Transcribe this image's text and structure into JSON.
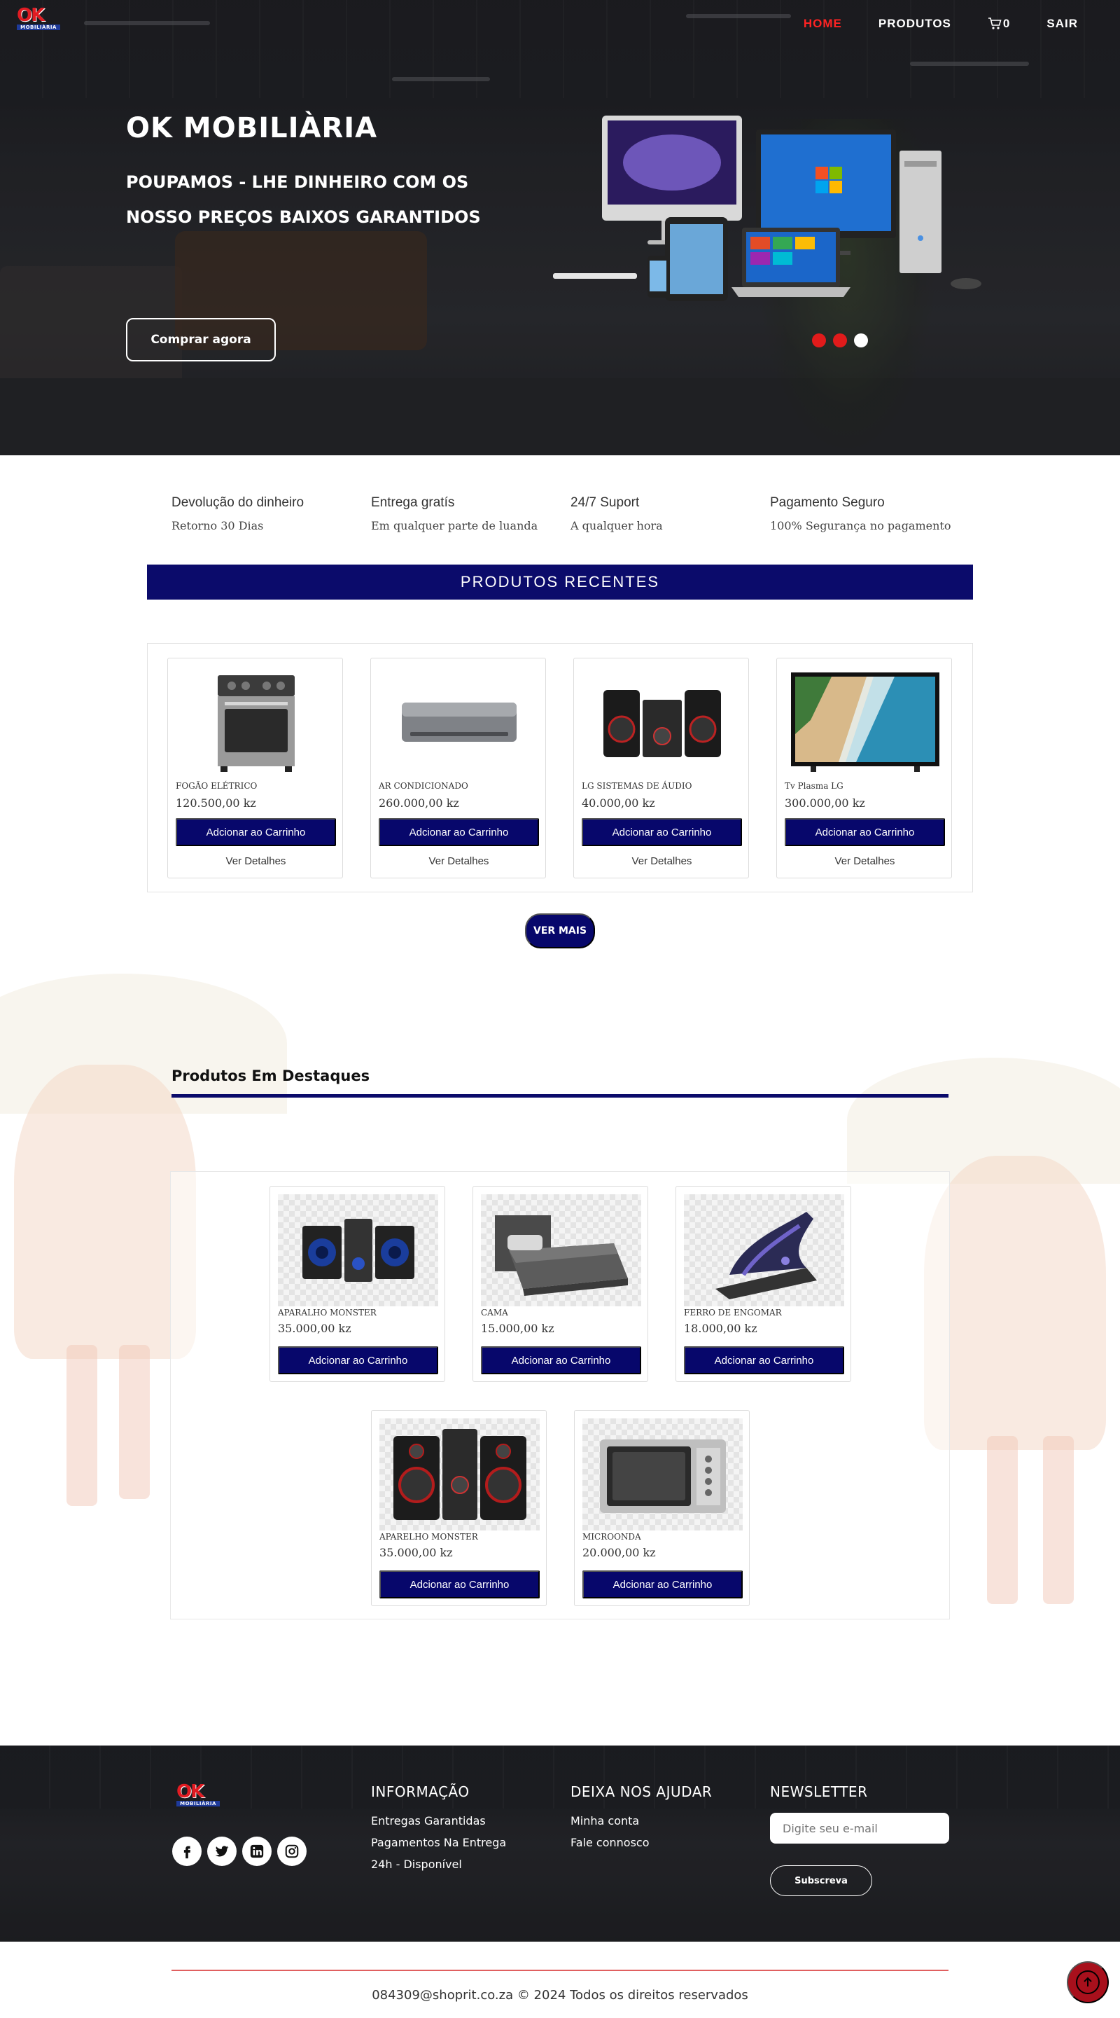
{
  "brand": {
    "logo_text": "OK",
    "logo_sub": "MOBILIÀRIA"
  },
  "nav": {
    "home": "HOME",
    "products": "PRODUTOS",
    "cart_count": "0",
    "logout": "SAIR",
    "active_color": "#ff2323"
  },
  "hero": {
    "title": "OK MOBILIÀRIA",
    "subtitle": "POUPAMOS - LHE DINHEIRO COM OS NOSSO PREÇOS BAIXOS GARANTIDOS",
    "cta": "Comprar agora",
    "slides": 3,
    "active_slide": 3
  },
  "features": [
    {
      "title": "Devolução do dinheiro",
      "desc": "Retorno 30 Dias"
    },
    {
      "title": "Entrega gratís",
      "desc": "Em qualquer parte de luanda"
    },
    {
      "title": "24/7 Suport",
      "desc": "A qualquer hora"
    },
    {
      "title": "Pagamento Seguro",
      "desc": "100% Segurança no pagamento"
    }
  ],
  "recent": {
    "heading": "PRODUTOS RECENTES",
    "add_label": "Adcionar ao Carrinho",
    "details_label": "Ver Detalhes",
    "more_label": "VER MAIS",
    "items": [
      {
        "name": "FOGÃO ELÉTRICO",
        "price": "120.500,00 kz",
        "icon": "stove-icon"
      },
      {
        "name": "AR CONDICIONADO",
        "price": "260.000,00 kz",
        "icon": "air-conditioner-icon"
      },
      {
        "name": "LG SISTEMAS DE ÁUDIO",
        "price": "40.000,00 kz",
        "icon": "audio-system-icon"
      },
      {
        "name": "Tv Plasma LG",
        "price": "300.000,00 kz",
        "icon": "tv-icon"
      }
    ]
  },
  "featured": {
    "heading": "Produtos Em Destaques",
    "add_label": "Adcionar ao Carrinho",
    "items": [
      {
        "name": "APARALHO MONSTER",
        "price": "35.000,00 kz",
        "icon": "speaker-system-icon"
      },
      {
        "name": "CAMA",
        "price": "15.000,00 kz",
        "icon": "bed-icon"
      },
      {
        "name": "FERRO DE ENGOMAR",
        "price": "18.000,00 kz",
        "icon": "iron-icon"
      },
      {
        "name": "APARELHO MONSTER",
        "price": "35.000,00 kz",
        "icon": "speaker-system-icon"
      },
      {
        "name": "MICROONDA",
        "price": "20.000,00 kz",
        "icon": "microwave-icon"
      }
    ]
  },
  "footer": {
    "info": {
      "heading": "INFORMAÇÃO",
      "links": [
        "Entregas Garantidas",
        "Pagamentos Na Entrega",
        "24h - Disponível"
      ]
    },
    "help": {
      "heading": "DEIXA NOS AJUDAR",
      "links": [
        "Minha conta",
        "Fale connosco"
      ]
    },
    "newsletter": {
      "heading": "NEWSLETTER",
      "placeholder": "Digite seu e-mail",
      "button": "Subscreva"
    },
    "social": [
      "facebook-icon",
      "twitter-icon",
      "linkedin-icon",
      "instagram-icon"
    ],
    "copyright": "084309@shoprit.co.za © 2024 Todos os direitos reservados"
  },
  "colors": {
    "primary": "#07076b",
    "accent_red": "#e11b22"
  }
}
